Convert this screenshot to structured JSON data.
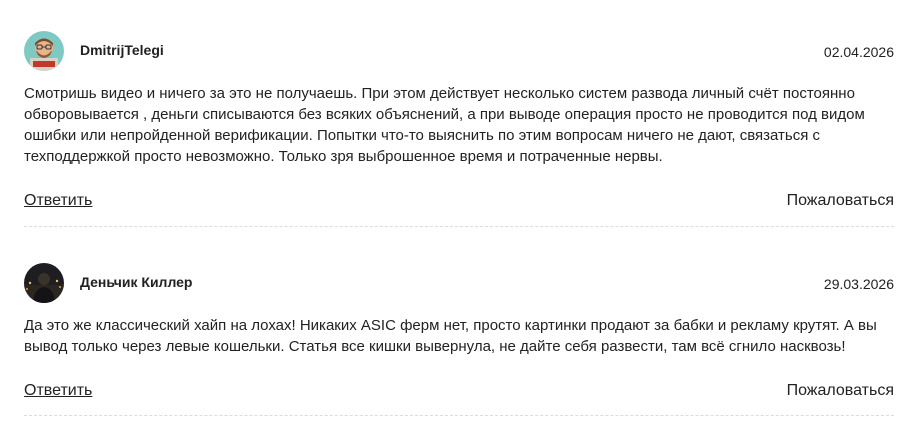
{
  "comments": [
    {
      "author": "DmitrijTelegi",
      "date": "02.04.2026",
      "avatar_icon": "cartoon-man-icon",
      "text": "Смотришь видео и ничего за это не получаешь. При этом действует несколько систем развода личный счёт постоянно обворовывается , деньги списываются без всяких объяснений, а при выводе операция просто не проводится под видом ошибки или непройденной верификации. Попытки что-то выяснить по этим вопросам ничего не дают, связаться с техподдержкой просто невозможно. Только зря выброшенное время и потраченные нервы.",
      "reply_label": "Ответить",
      "complain_label": "Пожаловаться"
    },
    {
      "author": "Деньчик Киллер",
      "date": "29.03.2026",
      "avatar_icon": "night-city-photo-icon",
      "text": "Да это же классический хайп на лохах! Никаких ASIC ферм нет, просто картинки продают за бабки и рекламу крутят. А вы вывод только через левые кошельки. Статья все кишки вывернула, не дайте себя развести, там всё сгнило насквозь!",
      "reply_label": "Ответить",
      "complain_label": "Пожаловаться"
    }
  ]
}
